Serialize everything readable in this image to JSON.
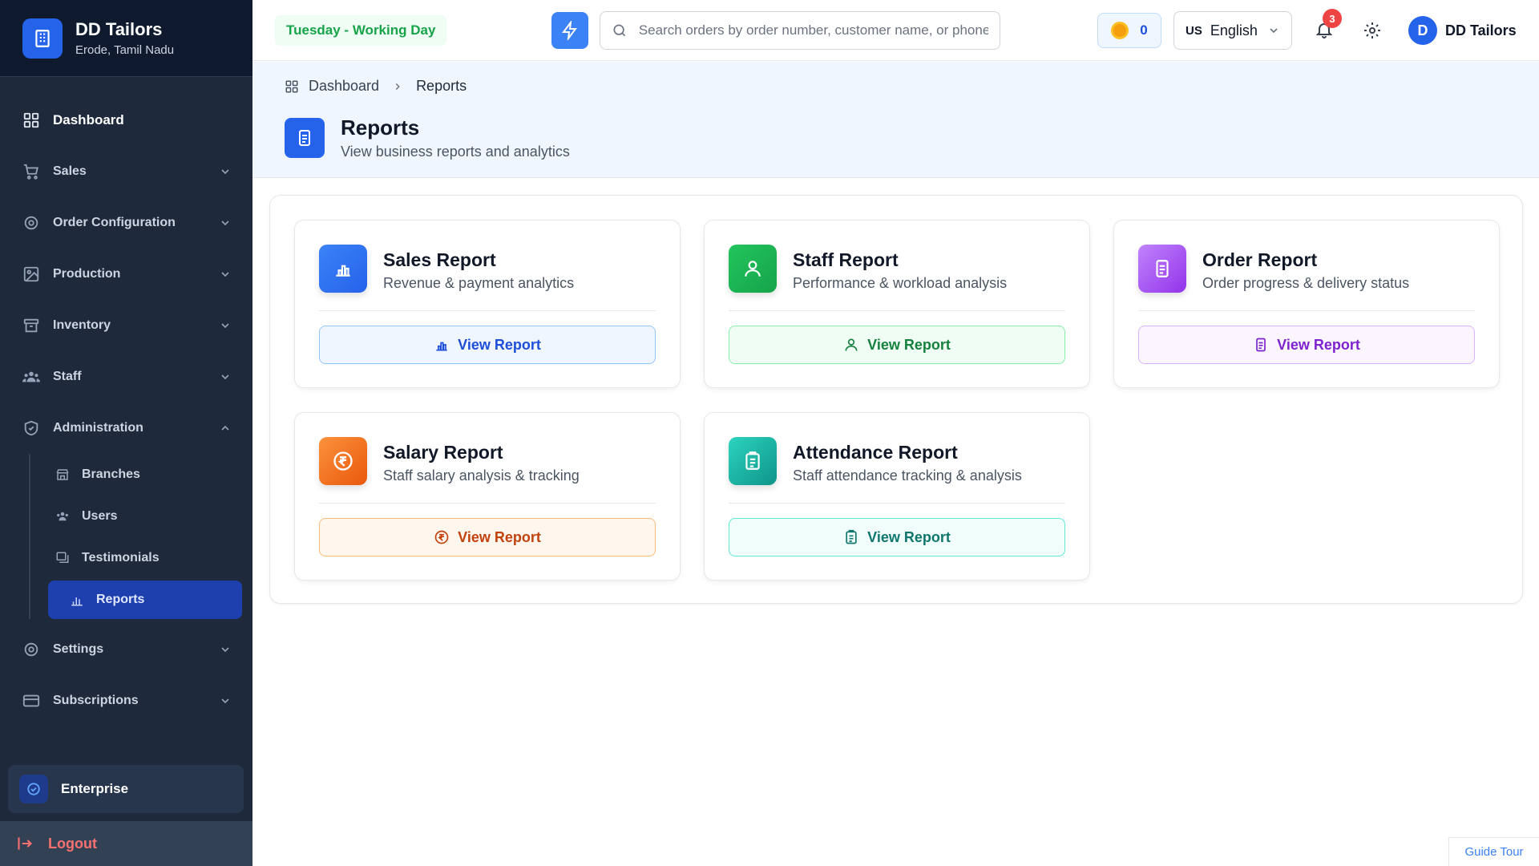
{
  "brand": {
    "name": "DD Tailors",
    "location": "Erode, Tamil Nadu",
    "icon": "building-icon"
  },
  "sidebar": {
    "items": [
      {
        "label": "Dashboard",
        "icon": "grid-icon"
      },
      {
        "label": "Sales",
        "icon": "cart-icon"
      },
      {
        "label": "Order Configuration",
        "icon": "gear-icon"
      },
      {
        "label": "Production",
        "icon": "image-icon"
      },
      {
        "label": "Inventory",
        "icon": "archive-icon"
      },
      {
        "label": "Staff",
        "icon": "people-icon"
      },
      {
        "label": "Administration",
        "icon": "shield-icon",
        "expanded": true
      },
      {
        "label": "Settings",
        "icon": "gear-icon"
      },
      {
        "label": "Subscriptions",
        "icon": "card-icon"
      }
    ],
    "admin_children": [
      {
        "label": "Branches",
        "icon": "store-icon"
      },
      {
        "label": "Users",
        "icon": "people-icon"
      },
      {
        "label": "Testimonials",
        "icon": "quote-icon"
      },
      {
        "label": "Reports",
        "icon": "bar-chart-icon",
        "active": true
      }
    ],
    "plan": "Enterprise",
    "logout": "Logout"
  },
  "topbar": {
    "day_status": "Tuesday - Working Day",
    "search_placeholder": "Search orders by order number, customer name, or phone...",
    "coins": "0",
    "language_flag": "US",
    "language": "English",
    "notifications_count": "3",
    "user_initial": "D",
    "user_name": "DD Tailors"
  },
  "breadcrumb": {
    "home": "Dashboard",
    "current": "Reports"
  },
  "page": {
    "title": "Reports",
    "subtitle": "View business reports and analytics"
  },
  "reports": [
    {
      "title": "Sales Report",
      "desc": "Revenue & payment analytics",
      "button": "View Report",
      "color": "#3b82f6",
      "icon": "bar-chart-icon"
    },
    {
      "title": "Staff Report",
      "desc": "Performance & workload analysis",
      "button": "View Report",
      "color": "#22c55e",
      "icon": "user-icon"
    },
    {
      "title": "Order Report",
      "desc": "Order progress & delivery status",
      "button": "View Report",
      "color": "#a855f7",
      "icon": "document-icon"
    },
    {
      "title": "Salary Report",
      "desc": "Staff salary analysis & tracking",
      "button": "View Report",
      "color": "#f97316",
      "icon": "rupee-icon"
    },
    {
      "title": "Attendance Report",
      "desc": "Staff attendance tracking & analysis",
      "button": "View Report",
      "color": "#14b8a6",
      "icon": "clipboard-icon"
    }
  ],
  "guide_tour": "Guide Tour"
}
